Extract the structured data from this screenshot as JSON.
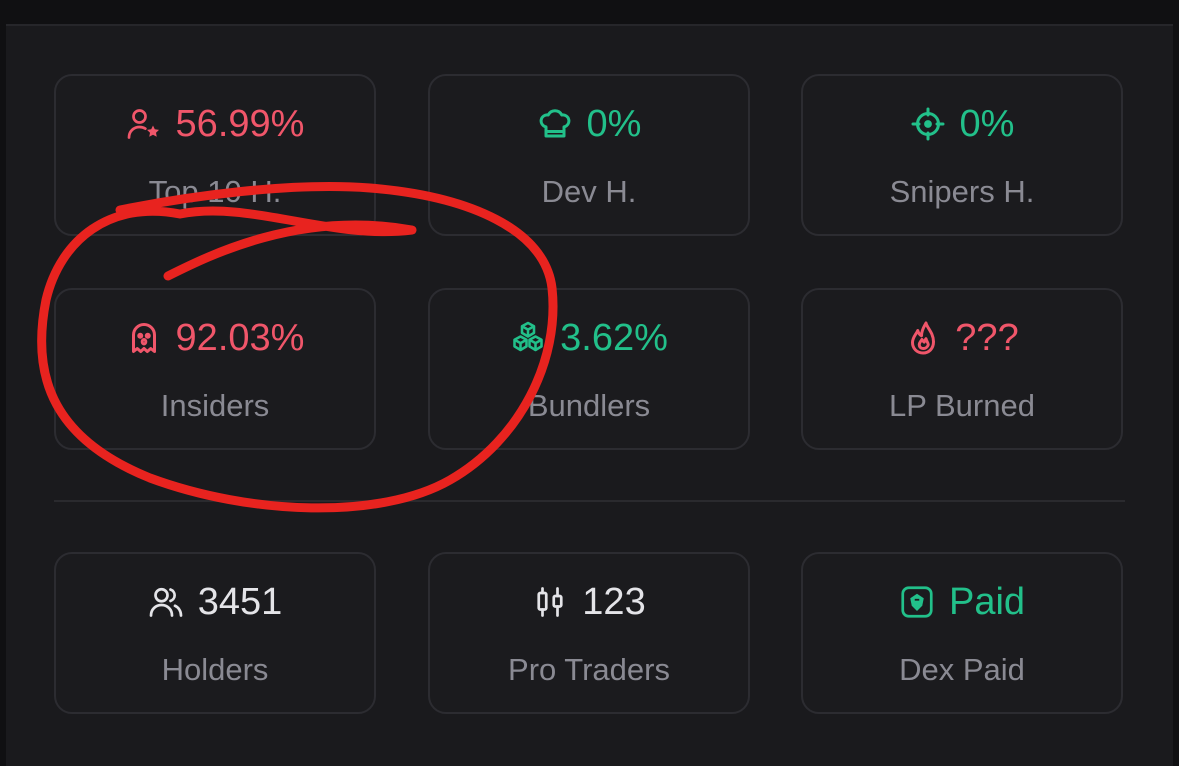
{
  "colors": {
    "risk_red": "#f0566a",
    "safe_green": "#22c08a",
    "neutral_white": "#e4e4e8",
    "label_gray": "#8a8a93",
    "annotation_red": "#e8231f"
  },
  "metrics_top": [
    {
      "value": "56.99%",
      "label": "Top 10 H.",
      "icon": "user-star-icon",
      "tone": "red"
    },
    {
      "value": "0%",
      "label": "Dev H.",
      "icon": "chef-hat-icon",
      "tone": "green"
    },
    {
      "value": "0%",
      "label": "Snipers H.",
      "icon": "crosshair-icon",
      "tone": "green"
    }
  ],
  "metrics_mid": [
    {
      "value": "92.03%",
      "label": "Insiders",
      "icon": "ghost-icon",
      "tone": "red"
    },
    {
      "value": "3.62%",
      "label": "Bundlers",
      "icon": "boxes-icon",
      "tone": "green"
    },
    {
      "value": "???",
      "label": "LP Burned",
      "icon": "flame-icon",
      "tone": "red"
    }
  ],
  "metrics_bottom": [
    {
      "value": "3451",
      "label": "Holders",
      "icon": "users-icon",
      "tone": "white"
    },
    {
      "value": "123",
      "label": "Pro Traders",
      "icon": "candlestick-icon",
      "tone": "white"
    },
    {
      "value": "Paid",
      "label": "Dex Paid",
      "icon": "dex-eagle-icon",
      "tone": "green"
    }
  ],
  "annotation": {
    "shape": "hand-drawn circle",
    "target": "Insiders card"
  }
}
